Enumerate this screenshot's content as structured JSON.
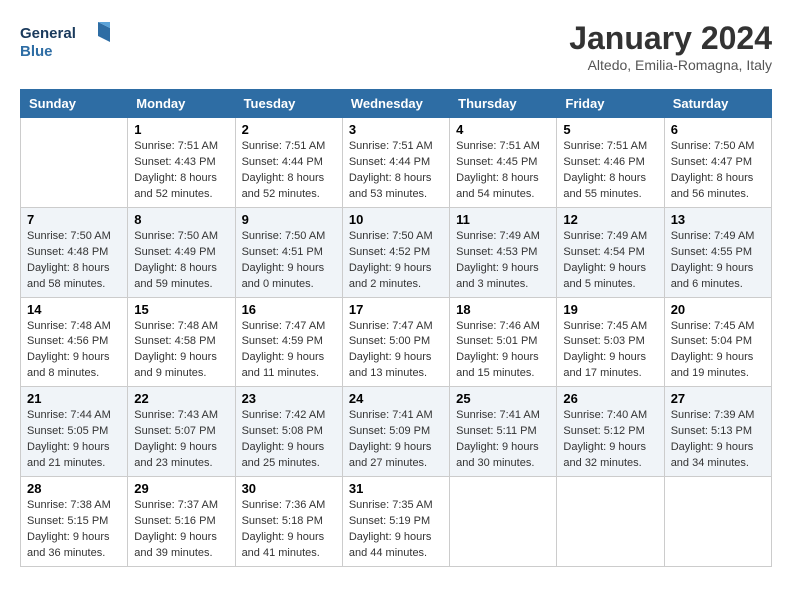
{
  "header": {
    "logo_text_general": "General",
    "logo_text_blue": "Blue",
    "month_year": "January 2024",
    "location": "Altedo, Emilia-Romagna, Italy"
  },
  "days_of_week": [
    "Sunday",
    "Monday",
    "Tuesday",
    "Wednesday",
    "Thursday",
    "Friday",
    "Saturday"
  ],
  "weeks": [
    [
      {
        "date": "",
        "info": ""
      },
      {
        "date": "1",
        "info": "Sunrise: 7:51 AM\nSunset: 4:43 PM\nDaylight: 8 hours\nand 52 minutes."
      },
      {
        "date": "2",
        "info": "Sunrise: 7:51 AM\nSunset: 4:44 PM\nDaylight: 8 hours\nand 52 minutes."
      },
      {
        "date": "3",
        "info": "Sunrise: 7:51 AM\nSunset: 4:44 PM\nDaylight: 8 hours\nand 53 minutes."
      },
      {
        "date": "4",
        "info": "Sunrise: 7:51 AM\nSunset: 4:45 PM\nDaylight: 8 hours\nand 54 minutes."
      },
      {
        "date": "5",
        "info": "Sunrise: 7:51 AM\nSunset: 4:46 PM\nDaylight: 8 hours\nand 55 minutes."
      },
      {
        "date": "6",
        "info": "Sunrise: 7:50 AM\nSunset: 4:47 PM\nDaylight: 8 hours\nand 56 minutes."
      }
    ],
    [
      {
        "date": "7",
        "info": "Sunrise: 7:50 AM\nSunset: 4:48 PM\nDaylight: 8 hours\nand 58 minutes."
      },
      {
        "date": "8",
        "info": "Sunrise: 7:50 AM\nSunset: 4:49 PM\nDaylight: 8 hours\nand 59 minutes."
      },
      {
        "date": "9",
        "info": "Sunrise: 7:50 AM\nSunset: 4:51 PM\nDaylight: 9 hours\nand 0 minutes."
      },
      {
        "date": "10",
        "info": "Sunrise: 7:50 AM\nSunset: 4:52 PM\nDaylight: 9 hours\nand 2 minutes."
      },
      {
        "date": "11",
        "info": "Sunrise: 7:49 AM\nSunset: 4:53 PM\nDaylight: 9 hours\nand 3 minutes."
      },
      {
        "date": "12",
        "info": "Sunrise: 7:49 AM\nSunset: 4:54 PM\nDaylight: 9 hours\nand 5 minutes."
      },
      {
        "date": "13",
        "info": "Sunrise: 7:49 AM\nSunset: 4:55 PM\nDaylight: 9 hours\nand 6 minutes."
      }
    ],
    [
      {
        "date": "14",
        "info": "Sunrise: 7:48 AM\nSunset: 4:56 PM\nDaylight: 9 hours\nand 8 minutes."
      },
      {
        "date": "15",
        "info": "Sunrise: 7:48 AM\nSunset: 4:58 PM\nDaylight: 9 hours\nand 9 minutes."
      },
      {
        "date": "16",
        "info": "Sunrise: 7:47 AM\nSunset: 4:59 PM\nDaylight: 9 hours\nand 11 minutes."
      },
      {
        "date": "17",
        "info": "Sunrise: 7:47 AM\nSunset: 5:00 PM\nDaylight: 9 hours\nand 13 minutes."
      },
      {
        "date": "18",
        "info": "Sunrise: 7:46 AM\nSunset: 5:01 PM\nDaylight: 9 hours\nand 15 minutes."
      },
      {
        "date": "19",
        "info": "Sunrise: 7:45 AM\nSunset: 5:03 PM\nDaylight: 9 hours\nand 17 minutes."
      },
      {
        "date": "20",
        "info": "Sunrise: 7:45 AM\nSunset: 5:04 PM\nDaylight: 9 hours\nand 19 minutes."
      }
    ],
    [
      {
        "date": "21",
        "info": "Sunrise: 7:44 AM\nSunset: 5:05 PM\nDaylight: 9 hours\nand 21 minutes."
      },
      {
        "date": "22",
        "info": "Sunrise: 7:43 AM\nSunset: 5:07 PM\nDaylight: 9 hours\nand 23 minutes."
      },
      {
        "date": "23",
        "info": "Sunrise: 7:42 AM\nSunset: 5:08 PM\nDaylight: 9 hours\nand 25 minutes."
      },
      {
        "date": "24",
        "info": "Sunrise: 7:41 AM\nSunset: 5:09 PM\nDaylight: 9 hours\nand 27 minutes."
      },
      {
        "date": "25",
        "info": "Sunrise: 7:41 AM\nSunset: 5:11 PM\nDaylight: 9 hours\nand 30 minutes."
      },
      {
        "date": "26",
        "info": "Sunrise: 7:40 AM\nSunset: 5:12 PM\nDaylight: 9 hours\nand 32 minutes."
      },
      {
        "date": "27",
        "info": "Sunrise: 7:39 AM\nSunset: 5:13 PM\nDaylight: 9 hours\nand 34 minutes."
      }
    ],
    [
      {
        "date": "28",
        "info": "Sunrise: 7:38 AM\nSunset: 5:15 PM\nDaylight: 9 hours\nand 36 minutes."
      },
      {
        "date": "29",
        "info": "Sunrise: 7:37 AM\nSunset: 5:16 PM\nDaylight: 9 hours\nand 39 minutes."
      },
      {
        "date": "30",
        "info": "Sunrise: 7:36 AM\nSunset: 5:18 PM\nDaylight: 9 hours\nand 41 minutes."
      },
      {
        "date": "31",
        "info": "Sunrise: 7:35 AM\nSunset: 5:19 PM\nDaylight: 9 hours\nand 44 minutes."
      },
      {
        "date": "",
        "info": ""
      },
      {
        "date": "",
        "info": ""
      },
      {
        "date": "",
        "info": ""
      }
    ]
  ]
}
